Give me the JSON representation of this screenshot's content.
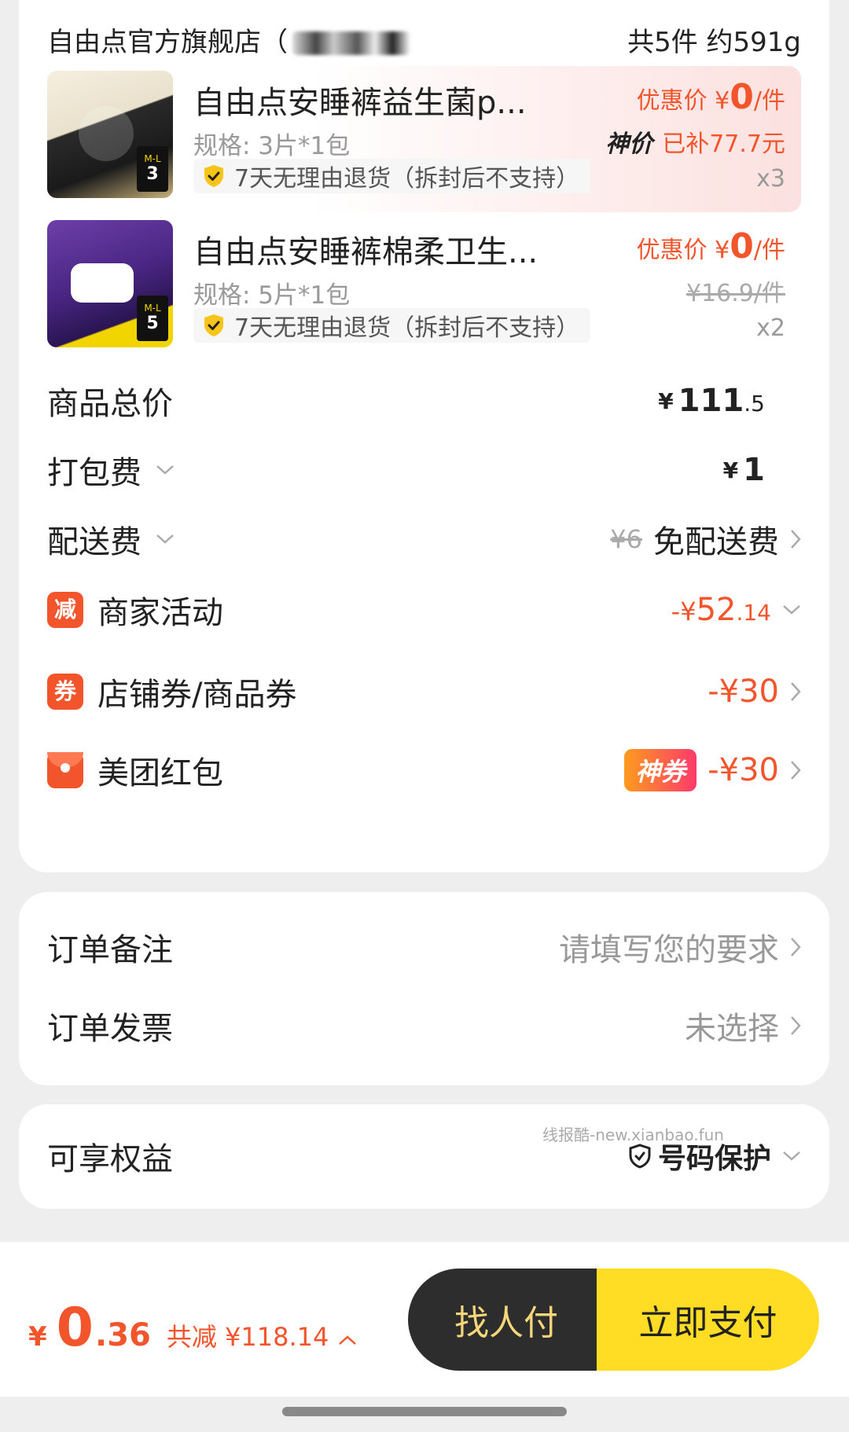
{
  "store": {
    "name": "自由点官方旗舰店（",
    "summary": "共5件 约591g"
  },
  "products": [
    {
      "name": "自由点安睡裤益生菌p...",
      "spec": "规格: 3片*1包",
      "return_policy": "7天无理由退货（拆封后不支持）",
      "price_prefix": "优惠价",
      "price_yen": "¥",
      "price_value": "0",
      "price_unit": "/件",
      "subsidy_logo": "神价",
      "subsidy_text": "已补77.7元",
      "qty": "x3"
    },
    {
      "name": "自由点安睡裤棉柔卫生...",
      "spec": "规格: 5片*1包",
      "return_policy": "7天无理由退货（拆封后不支持）",
      "price_prefix": "优惠价",
      "price_yen": "¥",
      "price_value": "0",
      "price_unit": "/件",
      "orig_price": "¥16.9/件",
      "qty": "x2"
    }
  ],
  "summary": {
    "goods_total_label": "商品总价",
    "goods_total_yen": "¥",
    "goods_total_int": "111",
    "goods_total_dec": ".5",
    "packing_label": "打包费",
    "packing_yen": "¥",
    "packing_value": "1",
    "delivery_label": "配送费",
    "delivery_orig": "¥6",
    "delivery_value": "免配送费",
    "merchant_icon": "减",
    "merchant_label": "商家活动",
    "merchant_prefix": "-¥",
    "merchant_int": "52",
    "merchant_dec": ".14",
    "coupon_icon": "券",
    "coupon_label": "店铺券/商品券",
    "coupon_value": "-¥30",
    "redpacket_label": "美团红包",
    "redpacket_tag": "神券",
    "redpacket_value": "-¥30"
  },
  "notes": {
    "remark_label": "订单备注",
    "remark_placeholder": "请填写您的要求",
    "invoice_label": "订单发票",
    "invoice_value": "未选择"
  },
  "rights": {
    "label": "可享权益",
    "watermark": "线报酷-new.xianbao.fun",
    "protect_label": "号码保护"
  },
  "bottom": {
    "yen": "¥",
    "total_int": "0",
    "total_dec": ".36",
    "saved_text": "共减 ¥118.14",
    "friend_pay": "找人付",
    "pay_now": "立即支付"
  },
  "colors": {
    "accent": "#f2552c",
    "pay_button": "#ffdd25",
    "friend_button": "#2d2d2d"
  }
}
